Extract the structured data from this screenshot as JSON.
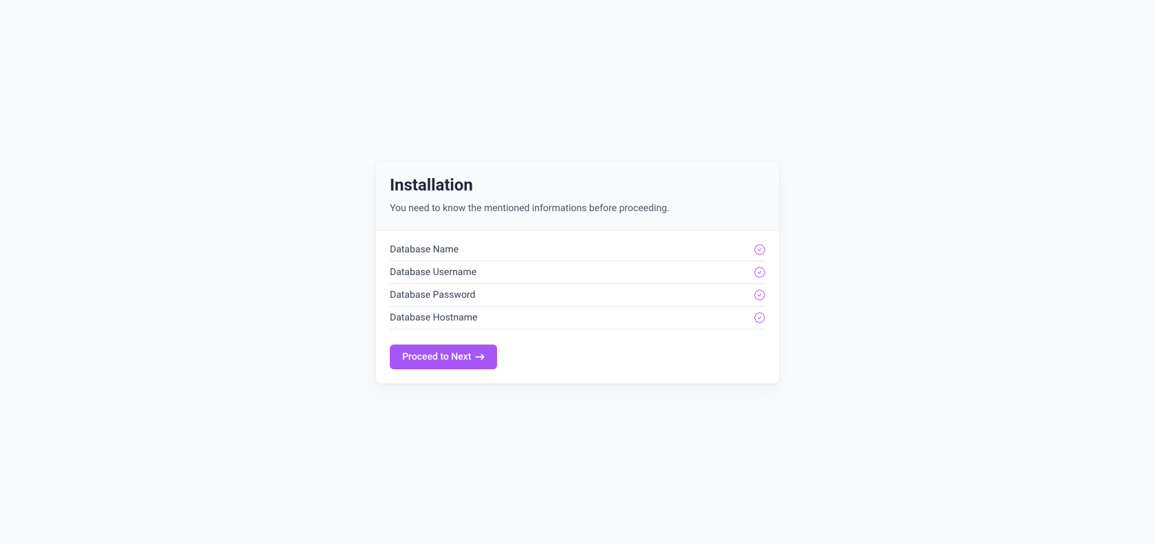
{
  "header": {
    "title": "Installation",
    "subtitle": "You need to know the mentioned informations before proceeding."
  },
  "requirements": {
    "items": [
      {
        "label": "Database Name",
        "status": "check"
      },
      {
        "label": "Database Username",
        "status": "check"
      },
      {
        "label": "Database Password",
        "status": "check"
      },
      {
        "label": "Database Hostname",
        "status": "check"
      }
    ]
  },
  "actions": {
    "proceed_label": "Proceed to Next"
  },
  "colors": {
    "accent": "#a855f7",
    "background": "#f9fafb",
    "card_background": "#ffffff",
    "border": "#e5e7eb",
    "text_primary": "#1f2937",
    "text_secondary": "#4b5563"
  }
}
